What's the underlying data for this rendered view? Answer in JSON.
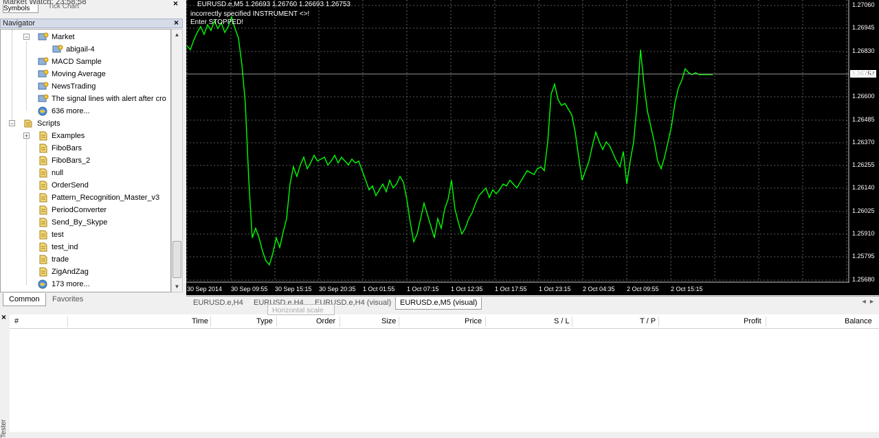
{
  "market_watch": {
    "title": "Market Watch: 23:58:58",
    "tabs": [
      "Symbols",
      "Tick Chart"
    ]
  },
  "navigator": {
    "title": "Navigator",
    "items": [
      {
        "label": "Market",
        "icon": "expert-icon"
      },
      {
        "label": "abigail-4",
        "icon": "expert-icon"
      },
      {
        "label": "MACD Sample",
        "icon": "expert-icon"
      },
      {
        "label": "Moving Average",
        "icon": "expert-icon"
      },
      {
        "label": "NewsTrading",
        "icon": "expert-icon"
      },
      {
        "label": "The signal lines with alert after cro",
        "icon": "expert-icon"
      },
      {
        "label": "636 more...",
        "icon": "globe-icon"
      },
      {
        "label": "Scripts",
        "icon": "script-folder-icon"
      },
      {
        "label": "Examples",
        "icon": "script-icon"
      },
      {
        "label": "FiboBars",
        "icon": "script-icon"
      },
      {
        "label": "FiboBars_2",
        "icon": "script-icon"
      },
      {
        "label": "null",
        "icon": "script-icon"
      },
      {
        "label": "OrderSend",
        "icon": "script-icon"
      },
      {
        "label": "Pattern_Recognition_Master_v3",
        "icon": "script-icon"
      },
      {
        "label": "PeriodConverter",
        "icon": "script-icon"
      },
      {
        "label": "Send_By_Skype",
        "icon": "script-icon"
      },
      {
        "label": "test",
        "icon": "script-icon"
      },
      {
        "label": "test_ind",
        "icon": "script-icon"
      },
      {
        "label": "trade",
        "icon": "script-icon"
      },
      {
        "label": "ZigAndZag",
        "icon": "script-icon"
      },
      {
        "label": "173 more...",
        "icon": "globe-icon"
      }
    ],
    "tabs": [
      "Common",
      "Favorites"
    ]
  },
  "chart": {
    "info_line": "EURUSD.e,M5  1.26693 1.26760 1.26693 1.26753",
    "message1": "incorrectly specified INSTRUMENT <>!",
    "message2": "Enter STOPPED!",
    "current_price": "1.26753",
    "line_color": "#00ff00",
    "background": "#000000"
  },
  "chart_data": {
    "type": "line",
    "symbol": "EURUSD.e,M5",
    "ylim": [
      1.2568,
      1.2711
    ],
    "y_ticks": [
      "1.27060",
      "1.26945",
      "1.26830",
      "1.26715",
      "1.26600",
      "1.26485",
      "1.26370",
      "1.26255",
      "1.26140",
      "1.26025",
      "1.25910",
      "1.25795",
      "1.25680"
    ],
    "x_ticks": [
      "30 Sep 2014",
      "30 Sep 09:55",
      "30 Sep 15:15",
      "30 Sep 20:35",
      "1 Oct 01:55",
      "1 Oct 07:15",
      "1 Oct 12:35",
      "1 Oct 17:55",
      "1 Oct 23:15",
      "2 Oct 04:35",
      "2 Oct 09:55",
      "2 Oct 15:15"
    ],
    "x": [
      0,
      5,
      10,
      15,
      20,
      25,
      30,
      35,
      40,
      45,
      50,
      55,
      60,
      65,
      70,
      75,
      80,
      85,
      90,
      95,
      100,
      105,
      110,
      115,
      120,
      125,
      130,
      135,
      140,
      145,
      150,
      155,
      160,
      165,
      170,
      175,
      180,
      185,
      190,
      195,
      200,
      205,
      210,
      215,
      220,
      225,
      230,
      235,
      240,
      245,
      250,
      255,
      260,
      265,
      270,
      275,
      280,
      285,
      290,
      295,
      300,
      305,
      310,
      315,
      320,
      325,
      330,
      335,
      340,
      345,
      350,
      355,
      360,
      365,
      370,
      375,
      380,
      385,
      390,
      395,
      400,
      405,
      410,
      415,
      420,
      425,
      430,
      435,
      440,
      445,
      450,
      455,
      460,
      465,
      470,
      475,
      480,
      485,
      490,
      495,
      500,
      505,
      510,
      515,
      520,
      525,
      530,
      535,
      540,
      545,
      550,
      555,
      560,
      565,
      570,
      575,
      580,
      585,
      590,
      595,
      600,
      605,
      610,
      615,
      620,
      625,
      630,
      635,
      640,
      645,
      650,
      655,
      660,
      665,
      670,
      675,
      680,
      685,
      690,
      695,
      700,
      705,
      710,
      715,
      720,
      725,
      730,
      735,
      740,
      745,
      750,
      755,
      760,
      765,
      770
    ],
    "values": [
      1.269,
      1.2688,
      1.2693,
      1.2697,
      1.27,
      1.2696,
      1.2701,
      1.2698,
      1.2703,
      1.2699,
      1.2702,
      1.2697,
      1.27,
      1.2705,
      1.2699,
      1.2694,
      1.268,
      1.266,
      1.262,
      1.259,
      1.2595,
      1.259,
      1.2583,
      1.2578,
      1.2576,
      1.2582,
      1.259,
      1.2585,
      1.2593,
      1.26,
      1.2618,
      1.2627,
      1.2622,
      1.2628,
      1.2632,
      1.2626,
      1.2629,
      1.2633,
      1.263,
      1.2631,
      1.2632,
      1.2628,
      1.263,
      1.2633,
      1.2629,
      1.2632,
      1.263,
      1.2628,
      1.2631,
      1.2629,
      1.263,
      1.2625,
      1.262,
      1.2615,
      1.2617,
      1.2612,
      1.2615,
      1.2618,
      1.2614,
      1.262,
      1.2616,
      1.2618,
      1.2622,
      1.2619,
      1.261,
      1.2598,
      1.2588,
      1.2592,
      1.26,
      1.2608,
      1.2602,
      1.2596,
      1.259,
      1.26,
      1.2595,
      1.2605,
      1.261,
      1.262,
      1.2605,
      1.2598,
      1.2592,
      1.2595,
      1.26,
      1.2603,
      1.2608,
      1.2612,
      1.2614,
      1.2616,
      1.2611,
      1.2615,
      1.2613,
      1.2615,
      1.2618,
      1.2617,
      1.262,
      1.2618,
      1.2616,
      1.2619,
      1.2622,
      1.2625,
      1.2624,
      1.2623,
      1.2626,
      1.2627,
      1.2625,
      1.264,
      1.2665,
      1.267,
      1.2662,
      1.2659,
      1.266,
      1.2657,
      1.2654,
      1.2645,
      1.2632,
      1.262,
      1.2625,
      1.263,
      1.2638,
      1.2645,
      1.264,
      1.2636,
      1.264,
      1.2638,
      1.2634,
      1.263,
      1.2627,
      1.2635,
      1.2618,
      1.263,
      1.264,
      1.266,
      1.2688,
      1.267,
      1.2656,
      1.2648,
      1.264,
      1.263,
      1.2626,
      1.2632,
      1.264,
      1.2648,
      1.266,
      1.2668,
      1.2672,
      1.2678,
      1.2676,
      1.2675,
      1.2676,
      1.2675,
      1.2675,
      1.2675,
      1.2675,
      1.2675
    ]
  },
  "chart_tabs": [
    "EURUSD.e,H4",
    "EURUSD.e,H4",
    "EURUSD.e,H4 (visual)",
    "EURUSD.e,M5 (visual)"
  ],
  "terminal": {
    "columns": [
      "#",
      "Time",
      "Type",
      "Order",
      "Size",
      "Price",
      "S / L",
      "T / P",
      "Profit",
      "Balance"
    ],
    "tooltip": "Horizontal scale",
    "side_label": "Tester"
  }
}
